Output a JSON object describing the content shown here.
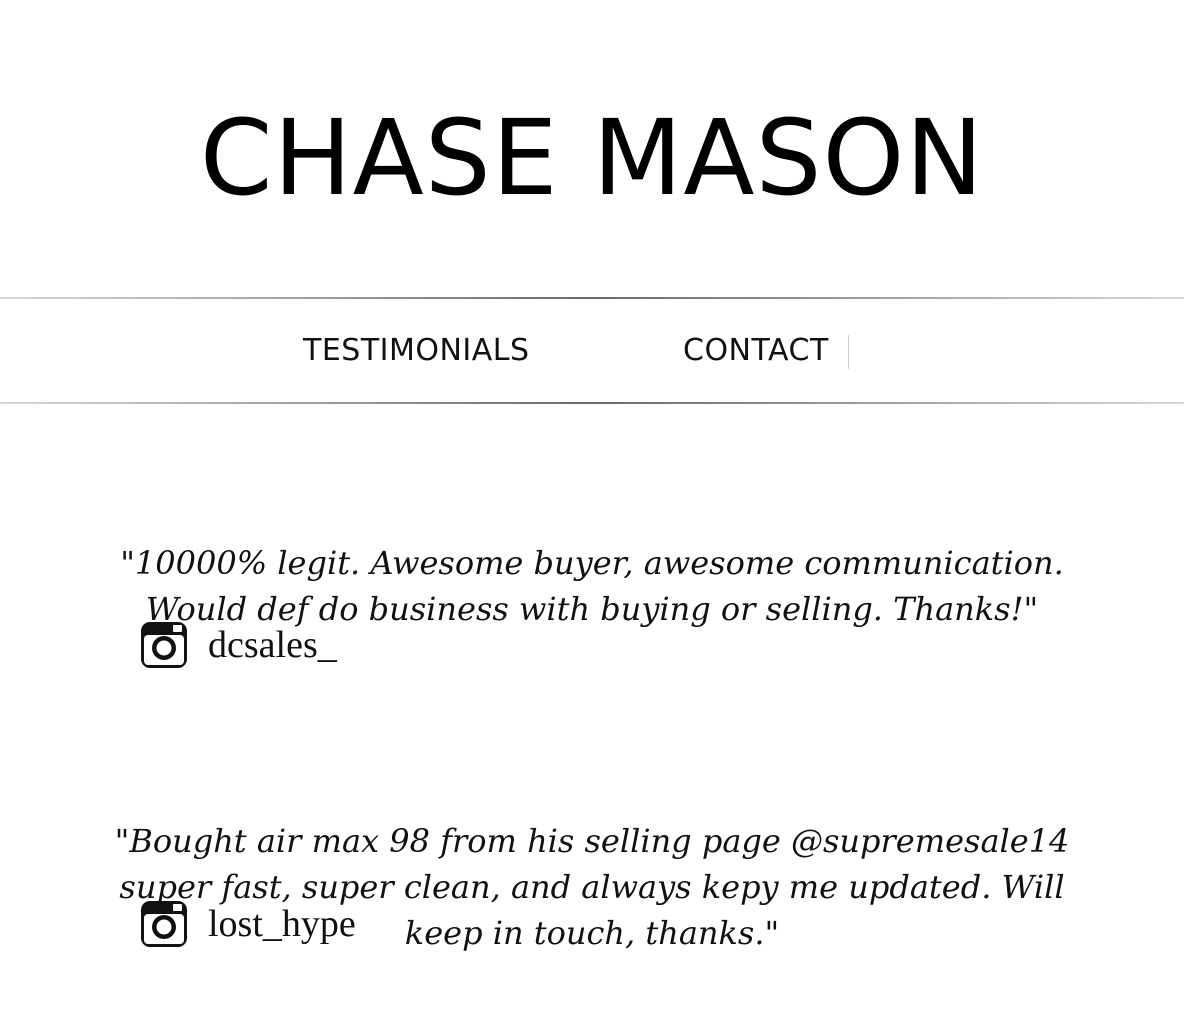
{
  "site": {
    "title": "CHASE MASON"
  },
  "nav": {
    "items": [
      {
        "label": "TESTIMONIALS"
      },
      {
        "label": "CONTACT"
      }
    ]
  },
  "testimonials": [
    {
      "quote": "\"10000% legit. Awesome buyer, awesome communication. Would def do business with buying or selling. Thanks!\"",
      "icon": "instagram-icon",
      "handle": "dcsales_"
    },
    {
      "quote": "\"Bought air max 98 from his selling page @supremesale14 super fast, super clean, and always kepy me updated. Will keep in touch, thanks.\"",
      "icon": "instagram-icon",
      "handle": "lost_hype"
    }
  ],
  "colors": {
    "background": "#ffffff",
    "text": "#111111",
    "divider": "#6a6a6a"
  }
}
